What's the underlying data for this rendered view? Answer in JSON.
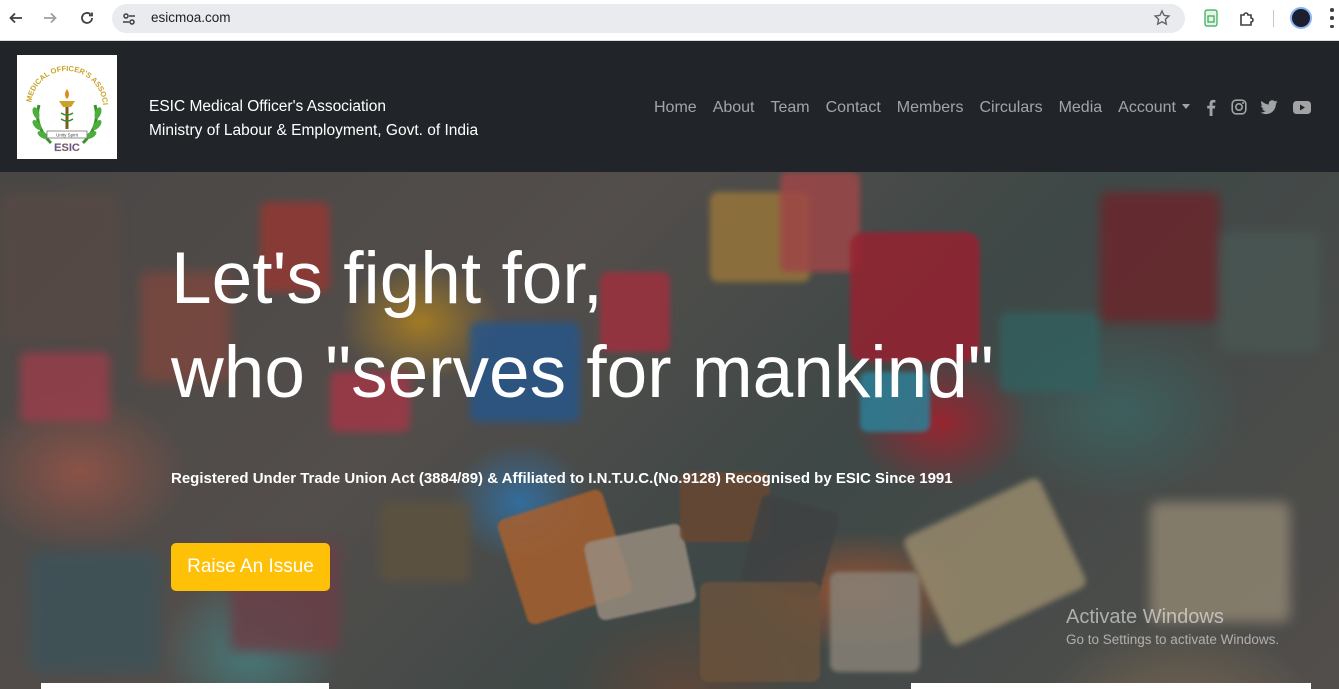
{
  "browser": {
    "url": "esicmoa.com"
  },
  "site": {
    "brand_line1": "ESIC Medical Officer's Association",
    "brand_line2": "Ministry of Labour & Employment, Govt. of India",
    "logo_text": "MEDICAL OFFICER'S ASSOCIATION · ESIC",
    "nav": [
      {
        "label": "Home"
      },
      {
        "label": "About"
      },
      {
        "label": "Team"
      },
      {
        "label": "Contact"
      },
      {
        "label": "Members"
      },
      {
        "label": "Circulars"
      },
      {
        "label": "Media"
      },
      {
        "label": "Account"
      }
    ],
    "social_icons": [
      "facebook-icon",
      "instagram-icon",
      "twitter-icon",
      "youtube-icon"
    ]
  },
  "hero": {
    "headline_line1": "Let's fight for,",
    "headline_line2": "who \"serves for mankind\"",
    "registration": "Registered Under Trade Union Act (3884/89) & Affiliated to I.N.T.U.C.(No.9128) Recognised by ESIC Since 1991",
    "cta_label": "Raise An Issue"
  },
  "watermark": {
    "line1": "Activate Windows",
    "line2": "Go to Settings to activate Windows."
  },
  "colors": {
    "header_bg": "#212529",
    "cta_bg": "#ffc107",
    "nav_text": "rgba(255,255,255,0.58)"
  }
}
